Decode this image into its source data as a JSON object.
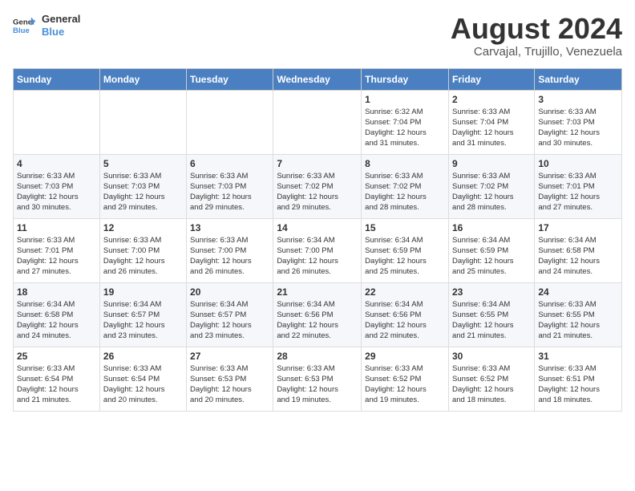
{
  "logo": {
    "line1": "General",
    "line2": "Blue"
  },
  "title": "August 2024",
  "subtitle": "Carvajal, Trujillo, Venezuela",
  "days_header": [
    "Sunday",
    "Monday",
    "Tuesday",
    "Wednesday",
    "Thursday",
    "Friday",
    "Saturday"
  ],
  "weeks": [
    [
      {
        "num": "",
        "info": ""
      },
      {
        "num": "",
        "info": ""
      },
      {
        "num": "",
        "info": ""
      },
      {
        "num": "",
        "info": ""
      },
      {
        "num": "1",
        "info": "Sunrise: 6:32 AM\nSunset: 7:04 PM\nDaylight: 12 hours\nand 31 minutes."
      },
      {
        "num": "2",
        "info": "Sunrise: 6:33 AM\nSunset: 7:04 PM\nDaylight: 12 hours\nand 31 minutes."
      },
      {
        "num": "3",
        "info": "Sunrise: 6:33 AM\nSunset: 7:03 PM\nDaylight: 12 hours\nand 30 minutes."
      }
    ],
    [
      {
        "num": "4",
        "info": "Sunrise: 6:33 AM\nSunset: 7:03 PM\nDaylight: 12 hours\nand 30 minutes."
      },
      {
        "num": "5",
        "info": "Sunrise: 6:33 AM\nSunset: 7:03 PM\nDaylight: 12 hours\nand 29 minutes."
      },
      {
        "num": "6",
        "info": "Sunrise: 6:33 AM\nSunset: 7:03 PM\nDaylight: 12 hours\nand 29 minutes."
      },
      {
        "num": "7",
        "info": "Sunrise: 6:33 AM\nSunset: 7:02 PM\nDaylight: 12 hours\nand 29 minutes."
      },
      {
        "num": "8",
        "info": "Sunrise: 6:33 AM\nSunset: 7:02 PM\nDaylight: 12 hours\nand 28 minutes."
      },
      {
        "num": "9",
        "info": "Sunrise: 6:33 AM\nSunset: 7:02 PM\nDaylight: 12 hours\nand 28 minutes."
      },
      {
        "num": "10",
        "info": "Sunrise: 6:33 AM\nSunset: 7:01 PM\nDaylight: 12 hours\nand 27 minutes."
      }
    ],
    [
      {
        "num": "11",
        "info": "Sunrise: 6:33 AM\nSunset: 7:01 PM\nDaylight: 12 hours\nand 27 minutes."
      },
      {
        "num": "12",
        "info": "Sunrise: 6:33 AM\nSunset: 7:00 PM\nDaylight: 12 hours\nand 26 minutes."
      },
      {
        "num": "13",
        "info": "Sunrise: 6:33 AM\nSunset: 7:00 PM\nDaylight: 12 hours\nand 26 minutes."
      },
      {
        "num": "14",
        "info": "Sunrise: 6:34 AM\nSunset: 7:00 PM\nDaylight: 12 hours\nand 26 minutes."
      },
      {
        "num": "15",
        "info": "Sunrise: 6:34 AM\nSunset: 6:59 PM\nDaylight: 12 hours\nand 25 minutes."
      },
      {
        "num": "16",
        "info": "Sunrise: 6:34 AM\nSunset: 6:59 PM\nDaylight: 12 hours\nand 25 minutes."
      },
      {
        "num": "17",
        "info": "Sunrise: 6:34 AM\nSunset: 6:58 PM\nDaylight: 12 hours\nand 24 minutes."
      }
    ],
    [
      {
        "num": "18",
        "info": "Sunrise: 6:34 AM\nSunset: 6:58 PM\nDaylight: 12 hours\nand 24 minutes."
      },
      {
        "num": "19",
        "info": "Sunrise: 6:34 AM\nSunset: 6:57 PM\nDaylight: 12 hours\nand 23 minutes."
      },
      {
        "num": "20",
        "info": "Sunrise: 6:34 AM\nSunset: 6:57 PM\nDaylight: 12 hours\nand 23 minutes."
      },
      {
        "num": "21",
        "info": "Sunrise: 6:34 AM\nSunset: 6:56 PM\nDaylight: 12 hours\nand 22 minutes."
      },
      {
        "num": "22",
        "info": "Sunrise: 6:34 AM\nSunset: 6:56 PM\nDaylight: 12 hours\nand 22 minutes."
      },
      {
        "num": "23",
        "info": "Sunrise: 6:34 AM\nSunset: 6:55 PM\nDaylight: 12 hours\nand 21 minutes."
      },
      {
        "num": "24",
        "info": "Sunrise: 6:33 AM\nSunset: 6:55 PM\nDaylight: 12 hours\nand 21 minutes."
      }
    ],
    [
      {
        "num": "25",
        "info": "Sunrise: 6:33 AM\nSunset: 6:54 PM\nDaylight: 12 hours\nand 21 minutes."
      },
      {
        "num": "26",
        "info": "Sunrise: 6:33 AM\nSunset: 6:54 PM\nDaylight: 12 hours\nand 20 minutes."
      },
      {
        "num": "27",
        "info": "Sunrise: 6:33 AM\nSunset: 6:53 PM\nDaylight: 12 hours\nand 20 minutes."
      },
      {
        "num": "28",
        "info": "Sunrise: 6:33 AM\nSunset: 6:53 PM\nDaylight: 12 hours\nand 19 minutes."
      },
      {
        "num": "29",
        "info": "Sunrise: 6:33 AM\nSunset: 6:52 PM\nDaylight: 12 hours\nand 19 minutes."
      },
      {
        "num": "30",
        "info": "Sunrise: 6:33 AM\nSunset: 6:52 PM\nDaylight: 12 hours\nand 18 minutes."
      },
      {
        "num": "31",
        "info": "Sunrise: 6:33 AM\nSunset: 6:51 PM\nDaylight: 12 hours\nand 18 minutes."
      }
    ]
  ]
}
